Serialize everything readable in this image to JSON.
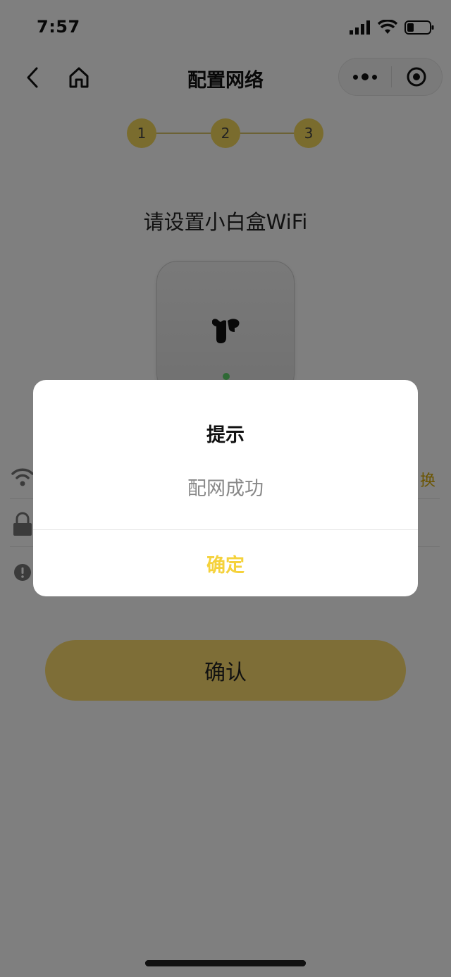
{
  "status_bar": {
    "time": "7:57"
  },
  "nav": {
    "title": "配置网络"
  },
  "stepper": {
    "steps": [
      "1",
      "2",
      "3"
    ]
  },
  "subtitle": "请设置小白盒WiFi",
  "form": {
    "switch_label": "换"
  },
  "confirm_button": "确认",
  "dialog": {
    "title": "提示",
    "message": "配网成功",
    "ok_label": "确定"
  },
  "colors": {
    "accent": "#f5d23c",
    "button_bg": "#fddc6e",
    "mask": "rgba(0,0,0,0.5)",
    "led": "#5fd36b"
  },
  "icons": [
    "cellular-signal-icon",
    "wifi-status-icon",
    "battery-icon",
    "back-arrow-icon",
    "home-icon",
    "more-icon",
    "close-target-icon",
    "wifi-icon",
    "lock-icon",
    "warning-icon",
    "device-logo-icon"
  ]
}
